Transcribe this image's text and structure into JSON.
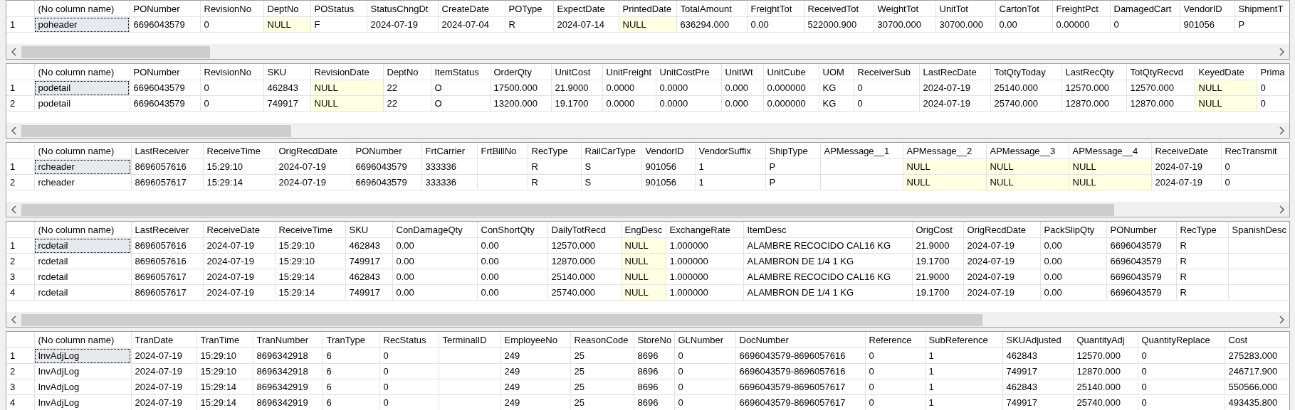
{
  "grids": [
    {
      "columns": [
        "(No column name)",
        "PONumber",
        "RevisionNo",
        "DeptNo",
        "POStatus",
        "StatusChngDt",
        "CreateDate",
        "POType",
        "ExpectDate",
        "PrintedDate",
        "TotalAmount",
        "FreightTot",
        "ReceivedTot",
        "WeightTot",
        "UnitTot",
        "CartonTot",
        "FreightPct",
        "DamagedCart",
        "VendorID",
        "ShipmentT"
      ],
      "rows": [
        {
          "number": "1",
          "selected": true,
          "cells": [
            "poheader",
            "6696043579",
            "0",
            {
              "text": "NULL",
              "null": true
            },
            "F",
            "2024-07-19",
            "2024-07-04",
            "R",
            "2024-07-14",
            {
              "text": "NULL",
              "null": true
            },
            "636294.000",
            "0.00",
            "522000.900",
            "30700.000",
            "30700.000",
            "0.00",
            "0.00000",
            "0",
            "901056",
            "P"
          ]
        }
      ]
    },
    {
      "columns": [
        "(No column name)",
        "PONumber",
        "RevisionNo",
        "SKU",
        "RevisionDate",
        "DeptNo",
        "ItemStatus",
        "OrderQty",
        "UnitCost",
        "UnitFreight",
        "UnitCostPre",
        "UnitWt",
        "UnitCube",
        "UOM",
        "ReceiverSub",
        "LastRecDate",
        "TotQtyToday",
        "LastRecQty",
        "TotQtyRecvd",
        "KeyedDate",
        "Prima"
      ],
      "rows": [
        {
          "number": "1",
          "selected": true,
          "cells": [
            "podetail",
            "6696043579",
            "0",
            "462843",
            {
              "text": "NULL",
              "null": true
            },
            "22",
            "O",
            "17500.000",
            "21.9000",
            "0.0000",
            "0.0000",
            "0.000",
            "0.000000",
            "KG",
            "0",
            "2024-07-19",
            "25140.000",
            "12570.000",
            "12570.000",
            {
              "text": "NULL",
              "null": true
            },
            "0"
          ]
        },
        {
          "number": "2",
          "selected": false,
          "cells": [
            "podetail",
            "6696043579",
            "0",
            "749917",
            {
              "text": "NULL",
              "null": true
            },
            "22",
            "O",
            "13200.000",
            "19.1700",
            "0.0000",
            "0.0000",
            "0.000",
            "0.000000",
            "KG",
            "0",
            "2024-07-19",
            "25740.000",
            "12870.000",
            "12870.000",
            {
              "text": "NULL",
              "null": true
            },
            "0"
          ]
        }
      ]
    },
    {
      "columns": [
        "(No column name)",
        "LastReceiver",
        "ReceiveTime",
        "OrigRecdDate",
        "PONumber",
        "FrtCarrier",
        "FrtBillNo",
        "RecType",
        "RailCarType",
        "VendorID",
        "VendorSuffix",
        "ShipType",
        "APMessage__1",
        "APMessage__2",
        "APMessage__3",
        "APMessage__4",
        "ReceiveDate",
        "RecTransmit"
      ],
      "rows": [
        {
          "number": "1",
          "selected": true,
          "cells": [
            "rcheader",
            "8696057616",
            "15:29:10",
            "2024-07-19",
            "6696043579",
            "333336",
            null,
            "R",
            "S",
            "901056",
            "1",
            "P",
            null,
            {
              "text": "NULL",
              "null": true
            },
            {
              "text": "NULL",
              "null": true
            },
            {
              "text": "NULL",
              "null": true
            },
            "2024-07-19",
            "0"
          ]
        },
        {
          "number": "2",
          "selected": false,
          "cells": [
            "rcheader",
            "8696057617",
            "15:29:14",
            "2024-07-19",
            "6696043579",
            "333336",
            null,
            "R",
            "S",
            "901056",
            "1",
            "P",
            null,
            {
              "text": "NULL",
              "null": true
            },
            {
              "text": "NULL",
              "null": true
            },
            {
              "text": "NULL",
              "null": true
            },
            "2024-07-19",
            "0"
          ]
        }
      ]
    },
    {
      "columns": [
        "(No column name)",
        "LastReceiver",
        "ReceiveDate",
        "ReceiveTime",
        "SKU",
        "ConDamageQty",
        "ConShortQty",
        "DailyTotRecd",
        "EngDesc",
        "ExchangeRate",
        "ItemDesc",
        "OrigCost",
        "OrigRecdDate",
        "PackSlipQty",
        "PONumber",
        "RecType",
        "SpanishDesc"
      ],
      "rows": [
        {
          "number": "1",
          "selected": true,
          "cells": [
            "rcdetail",
            "8696057616",
            "2024-07-19",
            "15:29:10",
            "462843",
            "0.00",
            "0.00",
            "12570.000",
            {
              "text": "NULL",
              "null": true
            },
            "1.000000",
            "ALAMBRE RECOCIDO  CAL16  KG",
            "21.9000",
            "2024-07-19",
            "0.00",
            "6696043579",
            "R",
            null
          ]
        },
        {
          "number": "2",
          "selected": false,
          "cells": [
            "rcdetail",
            "8696057616",
            "2024-07-19",
            "15:29:10",
            "749917",
            "0.00",
            "0.00",
            "12870.000",
            {
              "text": "NULL",
              "null": true
            },
            "1.000000",
            "ALAMBRON DE 1/4 1 KG",
            "19.1700",
            "2024-07-19",
            "0.00",
            "6696043579",
            "R",
            null
          ]
        },
        {
          "number": "3",
          "selected": false,
          "cells": [
            "rcdetail",
            "8696057617",
            "2024-07-19",
            "15:29:14",
            "462843",
            "0.00",
            "0.00",
            "25140.000",
            {
              "text": "NULL",
              "null": true
            },
            "1.000000",
            "ALAMBRE RECOCIDO  CAL16  KG",
            "21.9000",
            "2024-07-19",
            "0.00",
            "6696043579",
            "R",
            null
          ]
        },
        {
          "number": "4",
          "selected": false,
          "cells": [
            "rcdetail",
            "8696057617",
            "2024-07-19",
            "15:29:14",
            "749917",
            "0.00",
            "0.00",
            "25740.000",
            {
              "text": "NULL",
              "null": true
            },
            "1.000000",
            "ALAMBRON DE 1/4 1 KG",
            "19.1700",
            "2024-07-19",
            "0.00",
            "6696043579",
            "R",
            null
          ]
        }
      ]
    },
    {
      "columns": [
        "(No column name)",
        "TranDate",
        "TranTime",
        "TranNumber",
        "TranType",
        "RecStatus",
        "TerminalID",
        "EmployeeNo",
        "ReasonCode",
        "StoreNo",
        "GLNumber",
        "DocNumber",
        "Reference",
        "SubReference",
        "SKUAdjusted",
        "QuantityAdj",
        "QuantityReplace",
        "Cost"
      ],
      "rows": [
        {
          "number": "1",
          "selected": true,
          "cells": [
            "InvAdjLog",
            "2024-07-19",
            "15:29:10",
            "8696342918",
            "6",
            "0",
            null,
            "249",
            "25",
            "8696",
            "0",
            "6696043579-8696057616",
            "0",
            "1",
            "462843",
            "12570.000",
            "0",
            "275283.000"
          ]
        },
        {
          "number": "2",
          "selected": false,
          "cells": [
            "InvAdjLog",
            "2024-07-19",
            "15:29:10",
            "8696342918",
            "6",
            "0",
            null,
            "249",
            "25",
            "8696",
            "0",
            "6696043579-8696057616",
            "0",
            "1",
            "749917",
            "12870.000",
            "0",
            "246717.900"
          ]
        },
        {
          "number": "3",
          "selected": false,
          "cells": [
            "InvAdjLog",
            "2024-07-19",
            "15:29:14",
            "8696342919",
            "6",
            "0",
            null,
            "249",
            "25",
            "8696",
            "0",
            "6696043579-8696057617",
            "0",
            "1",
            "462843",
            "25140.000",
            "0",
            "550566.000"
          ]
        },
        {
          "number": "4",
          "selected": false,
          "cells": [
            "InvAdjLog",
            "2024-07-19",
            "15:29:14",
            "8696342919",
            "6",
            "0",
            null,
            "249",
            "25",
            "8696",
            "0",
            "6696043579-8696057617",
            "0",
            "1",
            "749917",
            "25740.000",
            "0",
            "493435.800"
          ]
        }
      ]
    }
  ]
}
